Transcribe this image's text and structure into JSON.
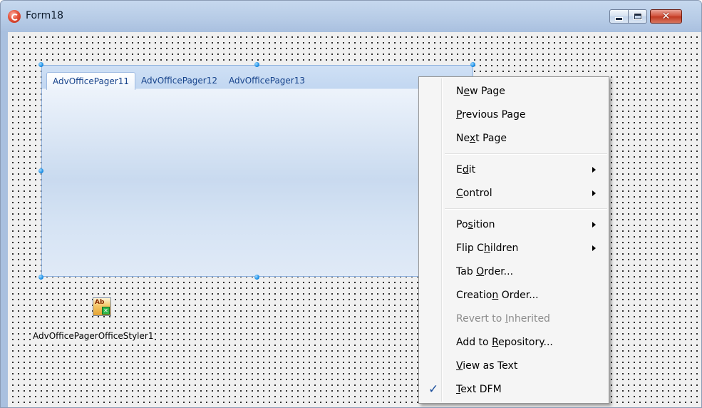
{
  "window": {
    "title": "Form18"
  },
  "pager": {
    "tabs": [
      {
        "label": "AdvOfficePager11",
        "active": true
      },
      {
        "label": "AdvOfficePager12",
        "active": false
      },
      {
        "label": "AdvOfficePager13",
        "active": false
      }
    ]
  },
  "component": {
    "label": "AdvOfficePagerOfficeStyler1",
    "icon_text": "Ab"
  },
  "context_menu": {
    "items": [
      {
        "label_pre": "N",
        "label_accel": "e",
        "label_post": "w Page"
      },
      {
        "label_pre": "",
        "label_accel": "P",
        "label_post": "revious Page"
      },
      {
        "label_pre": "Ne",
        "label_accel": "x",
        "label_post": "t Page"
      },
      {
        "label_pre": "E",
        "label_accel": "d",
        "label_post": "it",
        "submenu": true
      },
      {
        "label_pre": "",
        "label_accel": "C",
        "label_post": "ontrol",
        "submenu": true
      },
      {
        "label_pre": "Po",
        "label_accel": "s",
        "label_post": "ition",
        "submenu": true
      },
      {
        "label_pre": "Flip C",
        "label_accel": "h",
        "label_post": "ildren",
        "submenu": true
      },
      {
        "label_pre": "Tab ",
        "label_accel": "O",
        "label_post": "rder..."
      },
      {
        "label_pre": "Creatio",
        "label_accel": "n",
        "label_post": " Order..."
      },
      {
        "label_pre": "Revert to ",
        "label_accel": "I",
        "label_post": "nherited",
        "disabled": true
      },
      {
        "label_pre": "Add to ",
        "label_accel": "R",
        "label_post": "epository..."
      },
      {
        "label_pre": "",
        "label_accel": "V",
        "label_post": "iew as Text"
      },
      {
        "label_pre": "",
        "label_accel": "T",
        "label_post": "ext DFM",
        "checked": true
      }
    ],
    "check_glyph": "✓"
  },
  "colors": {
    "tab_text": "#15428b",
    "selection_handle": "#1c8fe6",
    "close_button": "#c03922"
  }
}
